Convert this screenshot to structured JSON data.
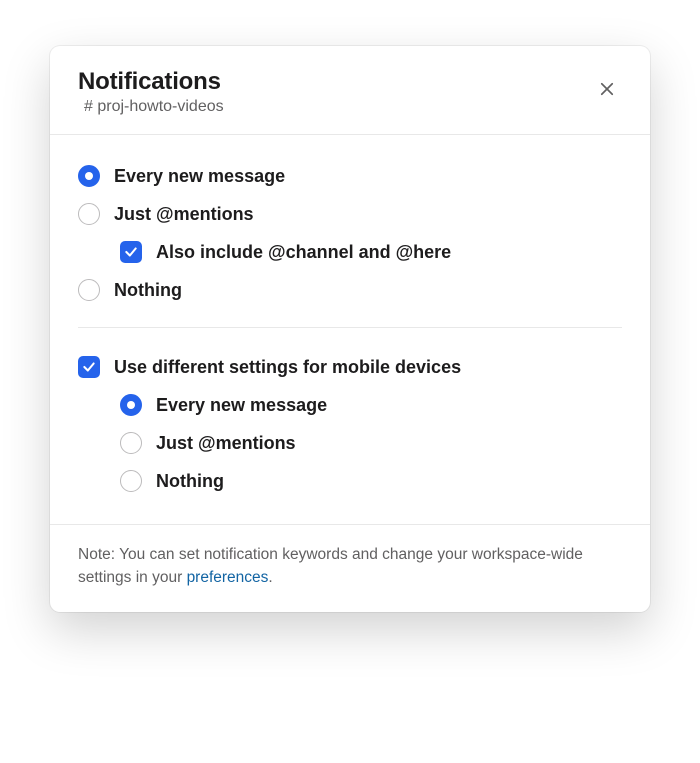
{
  "header": {
    "title": "Notifications",
    "channel": "# proj-howto-videos"
  },
  "options": {
    "every": "Every new message",
    "mentions": "Just @mentions",
    "include_channel_here": "Also include @channel and @here",
    "nothing": "Nothing",
    "mobile_toggle": "Use different settings for mobile devices"
  },
  "mobile_options": {
    "every": "Every new message",
    "mentions": "Just @mentions",
    "nothing": "Nothing"
  },
  "footer": {
    "note_prefix": "Note: You can set notification keywords and change your workspace-wide settings in your ",
    "link": "preferences",
    "note_suffix": "."
  }
}
